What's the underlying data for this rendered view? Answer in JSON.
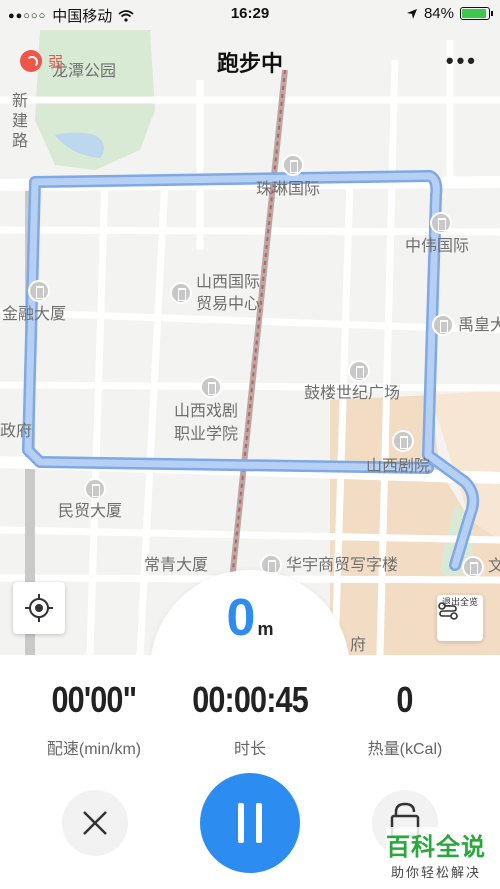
{
  "status_bar": {
    "signal_dots": "●●○○○",
    "carrier": "中国移动",
    "time": "16:29",
    "battery": "84%",
    "battery_level": 0.84,
    "icons": [
      "wifi-icon",
      "location-arrow-icon",
      "battery-icon"
    ]
  },
  "header": {
    "title": "跑步中",
    "gps_signal": "弱",
    "more_label": "•••"
  },
  "map": {
    "labels": {
      "longtan_park": "龙潭公园",
      "xinjian_road": "新建路",
      "zhulin": "珠琳国际",
      "zhongwei": "中伟国际",
      "shanxi_trade_1": "山西国际",
      "shanxi_trade_2": "贸易中心",
      "jinrong": "金融大厦",
      "yuhuang": "禹皇大",
      "gulou": "鼓楼世纪广场",
      "xiju_1": "山西戏剧",
      "xiju_2": "职业学院",
      "zhengfu": "政府",
      "juyuan": "山西剧院",
      "minmao": "民贸大厦",
      "changqing": "常青大厦",
      "huayu": "华宇商贸写字楼",
      "wen": "文",
      "fu": "府"
    },
    "overview_label": "退出全览"
  },
  "run": {
    "distance": "0",
    "distance_unit": "m",
    "pace": "00'00\"",
    "pace_label": "配速(min/km)",
    "duration": "00:00:45",
    "duration_label": "时长",
    "calories": "0",
    "calories_label": "热量(kCal)"
  },
  "watermark": {
    "main": "百科全说",
    "sub": "助你轻松解决"
  },
  "colors": {
    "accent": "#2d8cf0",
    "route": "#a9c7f2",
    "weak_signal": "#f0554a",
    "battery": "#3cc84a"
  }
}
